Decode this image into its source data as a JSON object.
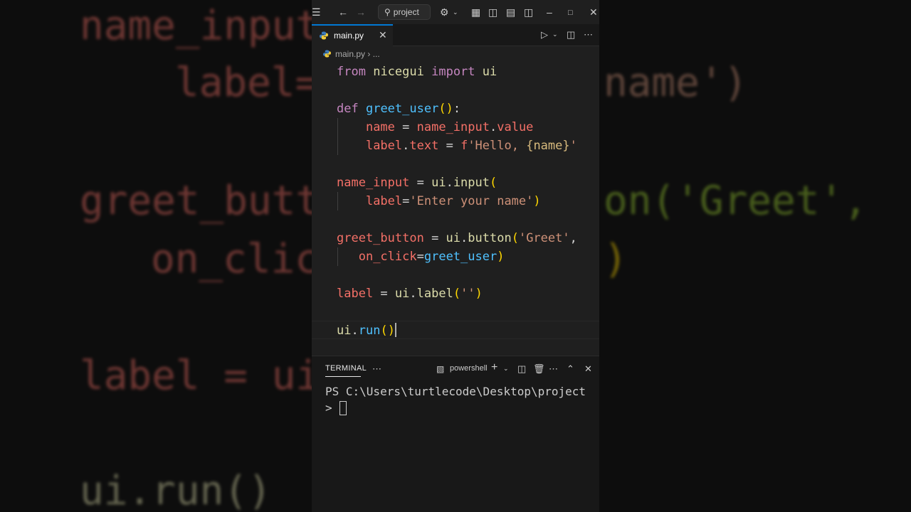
{
  "titlebar": {
    "search_text": "project",
    "icons": [
      "menu-icon",
      "back-arrow-icon",
      "forward-arrow-icon",
      "search-icon",
      "copilot-icon",
      "layout-icon",
      "toggle-sidebar-icon",
      "toggle-panel-icon",
      "toggle-secondary-sidebar-icon",
      "minimize-icon",
      "maximize-icon",
      "close-icon"
    ]
  },
  "tabs": [
    {
      "label": "main.py",
      "active": true
    }
  ],
  "breadcrumb": {
    "file": "main.py",
    "rest": "..."
  },
  "editor": {
    "lines": [
      [
        [
          "k",
          "from"
        ],
        [
          "p",
          " "
        ],
        [
          "f",
          "nicegui"
        ],
        [
          "p",
          " "
        ],
        [
          "k",
          "import"
        ],
        [
          "p",
          " "
        ],
        [
          "f",
          "ui"
        ]
      ],
      [],
      [
        [
          "k",
          "def"
        ],
        [
          "p",
          " "
        ],
        [
          "fb",
          "greet_user"
        ],
        [
          "b",
          "()"
        ],
        [
          "p",
          ":"
        ]
      ],
      [
        [
          "p",
          "    "
        ],
        [
          "v",
          "name"
        ],
        [
          "p",
          " = "
        ],
        [
          "v",
          "name_input"
        ],
        [
          "p",
          "."
        ],
        [
          "v",
          "value"
        ]
      ],
      [
        [
          "p",
          "    "
        ],
        [
          "v",
          "label"
        ],
        [
          "p",
          "."
        ],
        [
          "v",
          "text"
        ],
        [
          "p",
          " = "
        ],
        [
          "v",
          "f"
        ],
        [
          "s",
          "'Hello, "
        ],
        [
          "n",
          "{name}"
        ],
        [
          "s",
          "'"
        ]
      ],
      [],
      [
        [
          "v",
          "name_input"
        ],
        [
          "p",
          " = "
        ],
        [
          "f",
          "ui"
        ],
        [
          "p",
          "."
        ],
        [
          "f",
          "input"
        ],
        [
          "b",
          "("
        ]
      ],
      [
        [
          "p",
          "    "
        ],
        [
          "v",
          "label"
        ],
        [
          "p",
          "="
        ],
        [
          "s",
          "'Enter your name'"
        ],
        [
          "b",
          ")"
        ]
      ],
      [],
      [
        [
          "v",
          "greet_button"
        ],
        [
          "p",
          " = "
        ],
        [
          "f",
          "ui"
        ],
        [
          "p",
          "."
        ],
        [
          "f",
          "button"
        ],
        [
          "b",
          "("
        ],
        [
          "s",
          "'Greet'"
        ],
        [
          "p",
          ","
        ]
      ],
      [
        [
          "p",
          "   "
        ],
        [
          "v",
          "on_click"
        ],
        [
          "p",
          "="
        ],
        [
          "fb",
          "greet_user"
        ],
        [
          "b",
          ")"
        ]
      ],
      [],
      [
        [
          "v",
          "label"
        ],
        [
          "p",
          " = "
        ],
        [
          "f",
          "ui"
        ],
        [
          "p",
          "."
        ],
        [
          "f",
          "label"
        ],
        [
          "b",
          "("
        ],
        [
          "s",
          "''"
        ],
        [
          "b",
          ")"
        ]
      ],
      [],
      [
        [
          "f",
          "ui"
        ],
        [
          "p",
          "."
        ],
        [
          "fb",
          "run"
        ],
        [
          "b",
          "()"
        ]
      ]
    ]
  },
  "terminal": {
    "tab_label": "TERMINAL",
    "shell_label": "powershell",
    "lines": [
      "PS C:\\Users\\turtlecode\\Desktop\\project",
      ">"
    ]
  },
  "background": {
    "lines": [
      "name_input",
      "label=",
      "name')",
      "greet_butt",
      "on('Greet',",
      "on_clic",
      ")",
      "label = ui",
      "ui.run()"
    ]
  },
  "colors": {
    "accent": "#0078d4",
    "editor_bg": "#1f1f1f",
    "panel_bg": "#181818"
  }
}
